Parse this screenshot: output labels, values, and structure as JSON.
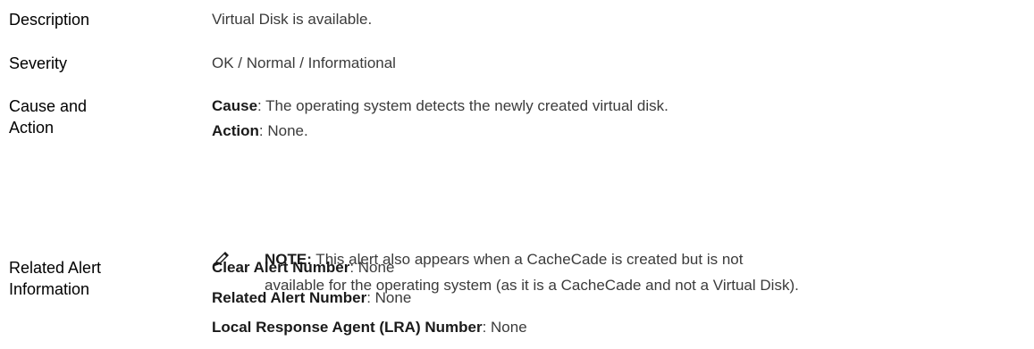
{
  "rows": {
    "description": {
      "label": "Description",
      "value": "Virtual Disk is available."
    },
    "severity": {
      "label": "Severity",
      "value": "OK / Normal / Informational"
    },
    "cause_action": {
      "label_line1": "Cause and",
      "label_line2": "Action",
      "cause_key": "Cause",
      "cause_text": ": The operating system detects the newly created virtual disk.",
      "action_key": "Action",
      "action_text": ": None."
    },
    "note": {
      "icon": "pencil-icon",
      "key": "NOTE:",
      "line1": " This alert also appears when a CacheCade is created but is not",
      "line2": "available for the operating system (as it is a CacheCade and not a Virtual Disk)."
    },
    "related": {
      "label_line1": "Related Alert",
      "label_line2": "Information",
      "clear_key": "Clear Alert Number",
      "clear_text": ": None",
      "related_key": "Related Alert Number",
      "related_text": ": None",
      "lra_key": "Local Response Agent (LRA) Number",
      "lra_text": ": None"
    }
  }
}
